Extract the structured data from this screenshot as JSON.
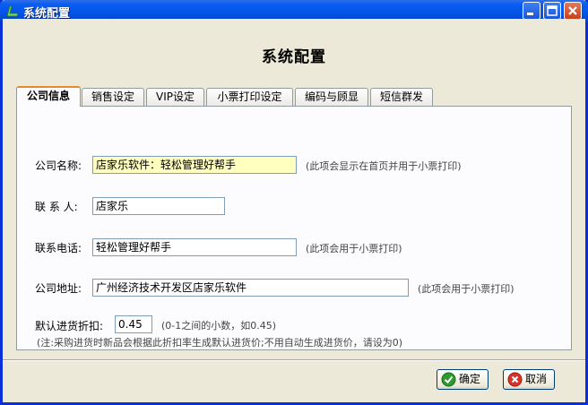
{
  "window": {
    "title": "系统配置"
  },
  "page": {
    "heading": "系统配置"
  },
  "tabs": [
    {
      "label": "公司信息",
      "active": true
    },
    {
      "label": "销售设定",
      "active": false
    },
    {
      "label": "VIP设定",
      "active": false
    },
    {
      "label": "小票打印设定",
      "active": false
    },
    {
      "label": "编码与顾显",
      "active": false
    },
    {
      "label": "短信群发",
      "active": false
    }
  ],
  "form": {
    "company_name": {
      "label": "公司名称:",
      "value": "店家乐软件：轻松管理好帮手",
      "hint": "(此项会显示在首页并用于小票打印)"
    },
    "contact": {
      "label": "联 系 人:",
      "value": "店家乐"
    },
    "phone": {
      "label": "联系电话:",
      "value": "轻松管理好帮手",
      "hint": "(此项会用于小票打印)"
    },
    "address": {
      "label": "公司地址:",
      "value": "广州经济技术开发区店家乐软件",
      "hint": "(此项会用于小票打印)"
    },
    "discount": {
      "label": "默认进货折扣:",
      "value": "0.45",
      "hint": "(0-1之间的小数，如0.45)"
    },
    "note": "(注:采购进货时新品会根据此折扣率生成默认进货价;不用自动生成进货价，请设为0)"
  },
  "buttons": {
    "ok": "确定",
    "cancel": "取消"
  },
  "icons": {
    "app": "app-logo-icon",
    "minimize": "minimize-icon",
    "maximize": "maximize-icon",
    "close": "close-icon",
    "ok": "check-icon",
    "cancel": "cancel-icon"
  },
  "colors": {
    "titlebar": "#0355e8",
    "active_tab_accent": "#e68b2c",
    "highlight_field": "#ffffc0"
  }
}
